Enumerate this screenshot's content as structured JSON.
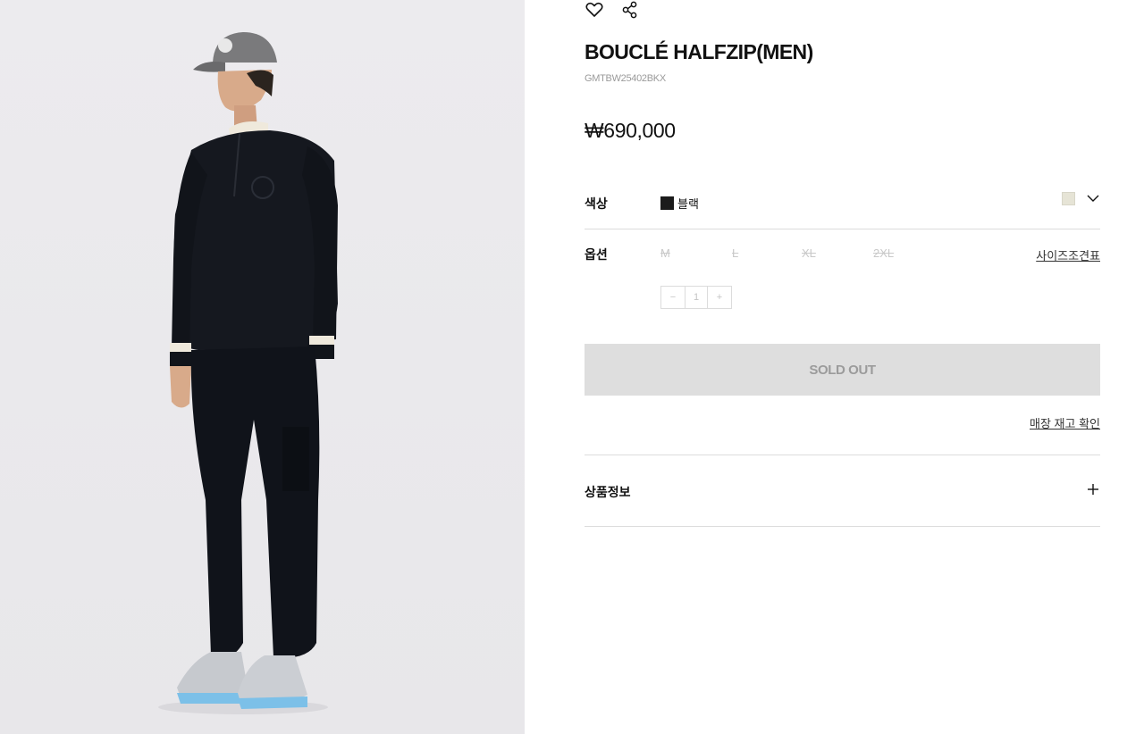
{
  "product_image": {
    "alt": ""
  },
  "actions": {
    "wishlist_icon": "heart-icon",
    "share_icon": "share-icon"
  },
  "product": {
    "name": "BOUCLÉ HALFZIP(MEN)",
    "code": "GMTBW25402BKX",
    "price": "₩690,000"
  },
  "color": {
    "label": "색상",
    "selected": "블랙",
    "selected_hex": "#1b1b1b",
    "alt_swatch_hex": "#e6e4d6",
    "dropdown_icon": "chevron-down-icon"
  },
  "option": {
    "label": "옵션",
    "sizes": [
      "M",
      "L",
      "XL",
      "2XL"
    ],
    "sizes_sold_out": true,
    "size_chart_link": "사이즈조견표"
  },
  "quantity": {
    "minus": "−",
    "value": "1",
    "plus": "+"
  },
  "buy": {
    "button_label": "SOLD OUT"
  },
  "store_check": {
    "label": "매장 재고 확인"
  },
  "details": {
    "label": "상품정보",
    "toggle_icon": "plus-icon"
  }
}
